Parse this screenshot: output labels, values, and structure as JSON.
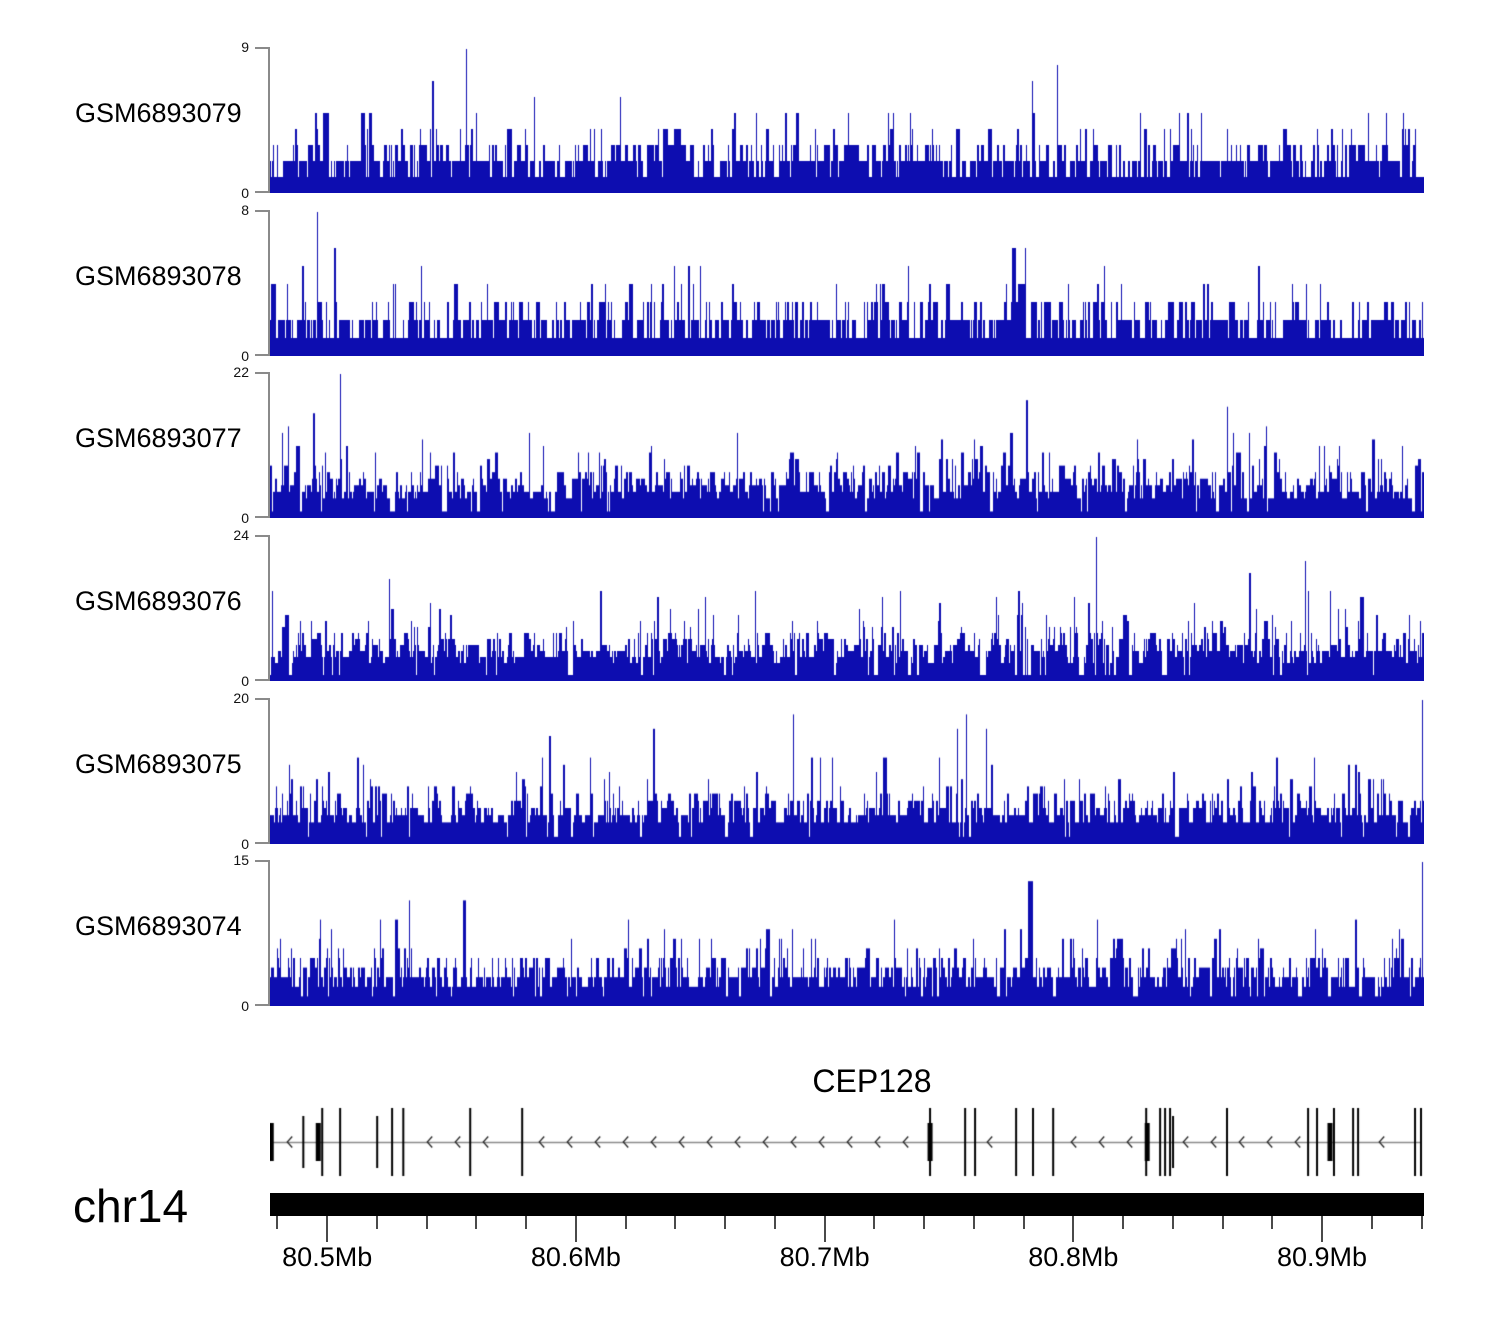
{
  "figure": {
    "background": "#ffffff",
    "coverage_color": "#0d0db0",
    "axis_line_color": "#8a8a8a",
    "tick_color": "#4a4a4a",
    "gene_line_color": "#8a8a8a",
    "exon_color": "#000000",
    "ideogram_color": "#000000",
    "text_color": "#000000"
  },
  "chart_data": {
    "type": "area",
    "description": "Read-coverage signal tracks for six GEO samples across chr14:80.48-80.94 Mb with the CEP128 gene model (minus strand) and a chromosome position axis",
    "region": {
      "chromosome": "chr14",
      "xmin_mb": 80.477,
      "xmax_mb": 80.941,
      "unit": "Mb"
    },
    "x_axis": {
      "major_ticks": [
        {
          "mb": 80.5,
          "label": "80.5Mb"
        },
        {
          "mb": 80.6,
          "label": "80.6Mb"
        },
        {
          "mb": 80.7,
          "label": "80.7Mb"
        },
        {
          "mb": 80.8,
          "label": "80.8Mb"
        },
        {
          "mb": 80.9,
          "label": "80.9Mb"
        }
      ],
      "minor_tick_start_mb": 80.48,
      "minor_tick_step_mb": 0.02,
      "minor_tick_end_mb": 80.94
    },
    "series": [
      {
        "name": "GSM6893079",
        "ymin": 0,
        "ymax": 9,
        "seed": 79,
        "peak_mb": 80.556,
        "signal": "dense noisy coverage, baseline 1-2, frequent spikes 3-5, single max 9"
      },
      {
        "name": "GSM6893078",
        "ymin": 0,
        "ymax": 8,
        "seed": 78,
        "peak_mb": 80.496,
        "signal": "dense noisy coverage, baseline 1-2, frequent spikes 3-5, single max 8"
      },
      {
        "name": "GSM6893077",
        "ymin": 0,
        "ymax": 22,
        "seed": 77,
        "peak_mb": 80.505,
        "signal": "dense noisy coverage, baseline 2-5, frequent spikes 7-10, single max 22"
      },
      {
        "name": "GSM6893076",
        "ymin": 0,
        "ymax": 24,
        "seed": 76,
        "peak_mb": 80.809,
        "signal": "dense noisy coverage, baseline 2-5, frequent spikes 8-11, single max 24"
      },
      {
        "name": "GSM6893075",
        "ymin": 0,
        "ymax": 20,
        "seed": 75,
        "peak_mb": 80.94,
        "signal": "dense noisy coverage, baseline 2-4, frequent spikes 6-9, single max 20 at right edge"
      },
      {
        "name": "GSM6893074",
        "ymin": 0,
        "ymax": 15,
        "seed": 74,
        "peak_mb": 80.94,
        "signal": "dense noisy coverage, baseline 1-3, frequent spikes 4-7, single max 15 at right edge"
      }
    ],
    "gene_track": {
      "gene_name": "CEP128",
      "strand": "-",
      "exons": [
        {
          "mb": 80.4775,
          "type": "thick"
        },
        {
          "mb": 80.4904,
          "type": "med"
        },
        {
          "mb": 80.4964,
          "type": "thick"
        },
        {
          "mb": 80.498,
          "type": "tall"
        },
        {
          "mb": 80.5052,
          "type": "tall"
        },
        {
          "mb": 80.5201,
          "type": "med"
        },
        {
          "mb": 80.5261,
          "type": "tall"
        },
        {
          "mb": 80.5306,
          "type": "tall"
        },
        {
          "mb": 80.5575,
          "type": "tall"
        },
        {
          "mb": 80.5784,
          "type": "tall"
        },
        {
          "mb": 80.7424,
          "type": "tall"
        },
        {
          "mb": 80.7424,
          "type": "thick"
        },
        {
          "mb": 80.7565,
          "type": "tall"
        },
        {
          "mb": 80.7605,
          "type": "tall"
        },
        {
          "mb": 80.777,
          "type": "tall"
        },
        {
          "mb": 80.7838,
          "type": "tall"
        },
        {
          "mb": 80.7919,
          "type": "tall"
        },
        {
          "mb": 80.8293,
          "type": "tall"
        },
        {
          "mb": 80.8297,
          "type": "thick"
        },
        {
          "mb": 80.8349,
          "type": "tall"
        },
        {
          "mb": 80.8369,
          "type": "tall"
        },
        {
          "mb": 80.8389,
          "type": "tall"
        },
        {
          "mb": 80.8401,
          "type": "med"
        },
        {
          "mb": 80.8618,
          "type": "tall"
        },
        {
          "mb": 80.8944,
          "type": "tall"
        },
        {
          "mb": 80.898,
          "type": "tall"
        },
        {
          "mb": 80.9032,
          "type": "thick"
        },
        {
          "mb": 80.9048,
          "type": "tall"
        },
        {
          "mb": 80.9125,
          "type": "tall"
        },
        {
          "mb": 80.9145,
          "type": "tall"
        },
        {
          "mb": 80.9374,
          "type": "tall"
        },
        {
          "mb": 80.9398,
          "type": "tall"
        }
      ]
    }
  }
}
